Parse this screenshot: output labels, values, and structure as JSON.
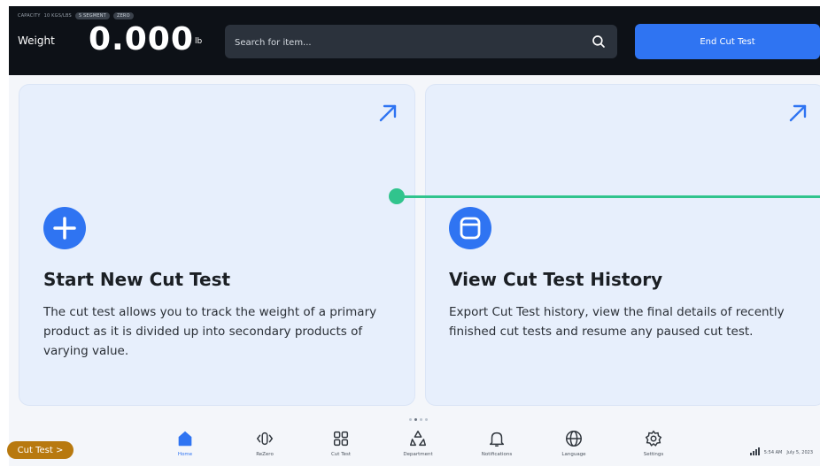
{
  "header": {
    "capacity_label": "CAPACITY",
    "capacity_value": "10 KGS/LBS",
    "chips": [
      "S SEGMENT",
      "ZERO"
    ],
    "weight_label": "Weight",
    "weight_value": "0.000",
    "weight_unit": "lb",
    "search_placeholder": "Search for item...",
    "end_button": "End Cut Test"
  },
  "cards": [
    {
      "title": "Start New Cut Test",
      "description": "The cut test allows you to track the weight of a primary product as it is divided up into secondary products of varying value.",
      "icon": "plus-icon"
    },
    {
      "title": "View Cut Test History",
      "description": "Export Cut Test history, view the final details of recently finished cut tests and resume any paused cut test.",
      "icon": "document-icon"
    }
  ],
  "nav": [
    {
      "label": "Home",
      "icon": "home-icon",
      "active": true
    },
    {
      "label": "ReZero",
      "icon": "rezero-icon"
    },
    {
      "label": "Cut Test",
      "icon": "grid-icon"
    },
    {
      "label": "Department",
      "icon": "recycle-icon"
    },
    {
      "label": "Notifications",
      "icon": "bell-icon"
    },
    {
      "label": "Language",
      "icon": "globe-icon"
    },
    {
      "label": "Settings",
      "icon": "gear-icon"
    }
  ],
  "footer": {
    "cut_test_pill": "Cut Test >",
    "time": "5:54 AM",
    "date": "July 5, 2023"
  },
  "colors": {
    "accent": "#2f74f2",
    "header_bg": "#0d1117",
    "card_bg": "#e7effc",
    "teal": "#31c48d",
    "pill": "#b8790f"
  }
}
